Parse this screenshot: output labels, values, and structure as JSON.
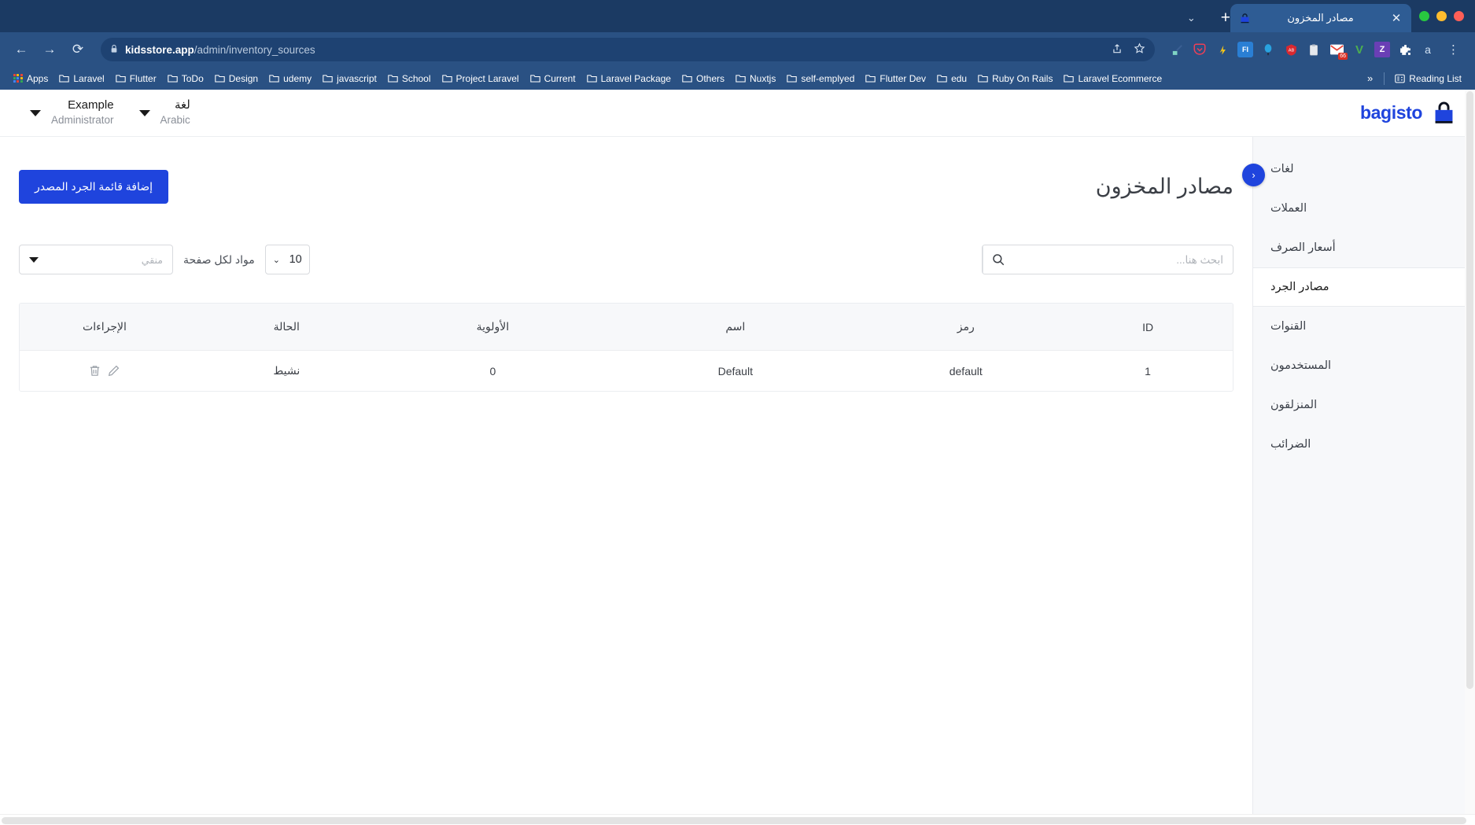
{
  "browser": {
    "tab": {
      "title": "مصادر المخزون",
      "favicon": "bag-icon",
      "close_label": "✕"
    },
    "new_tab_label": "+",
    "window_controls": [
      "close",
      "minimize",
      "maximize"
    ],
    "nav": {
      "back": "←",
      "forward": "→",
      "reload": "⟳"
    },
    "omnibox": {
      "lock": "🔒",
      "url_bold": "kidsstore.app",
      "url_rest": "/admin/inventory_sources",
      "share_icon": "share-icon",
      "bookmark_icon": "star-icon"
    },
    "extensions": [
      {
        "name": "eyedropper-extension",
        "glyph": "🖊",
        "color": "#2f5a8f"
      },
      {
        "name": "pocket-extension",
        "glyph": "▽",
        "color": "#ef3f56"
      },
      {
        "name": "lightning-extension",
        "glyph": "⚡",
        "color": "#f5c518"
      },
      {
        "name": "fi-extension",
        "glyph": "FI",
        "color": "#2a7fd4"
      },
      {
        "name": "balloon-extension",
        "glyph": "◆",
        "color": "#29a3e0"
      },
      {
        "name": "adblock-extension",
        "glyph": "ABP",
        "color": "#d9282f"
      },
      {
        "name": "clipboard-extension",
        "glyph": "▯",
        "color": "#e6e9ee"
      },
      {
        "name": "gmail-extension",
        "glyph": "M",
        "color": "#e94235",
        "badge": "66"
      },
      {
        "name": "vimeo-extension",
        "glyph": "V",
        "color": "#4caf50"
      },
      {
        "name": "zotero-extension",
        "glyph": "Z",
        "color": "#6a3fb5"
      },
      {
        "name": "puzzle-extension",
        "glyph": "🧩",
        "color": "#ffffff"
      },
      {
        "name": "grammarly-extension",
        "glyph": "a",
        "color": "#cfe0f2"
      }
    ],
    "menu_label": "⋮",
    "bookmarks": [
      {
        "label": "Apps",
        "icon": "apps-grid-icon"
      },
      {
        "label": "Laravel",
        "icon": "folder-icon"
      },
      {
        "label": "Flutter",
        "icon": "folder-icon"
      },
      {
        "label": "ToDo",
        "icon": "folder-icon"
      },
      {
        "label": "Design",
        "icon": "folder-icon"
      },
      {
        "label": "udemy",
        "icon": "folder-icon"
      },
      {
        "label": "javascript",
        "icon": "folder-icon"
      },
      {
        "label": "School",
        "icon": "folder-icon"
      },
      {
        "label": "Project Laravel",
        "icon": "folder-icon"
      },
      {
        "label": "Current",
        "icon": "folder-icon"
      },
      {
        "label": "Laravel Package",
        "icon": "folder-icon"
      },
      {
        "label": "Others",
        "icon": "folder-icon"
      },
      {
        "label": "Nuxtjs",
        "icon": "folder-icon"
      },
      {
        "label": "self-emplyed",
        "icon": "folder-icon"
      },
      {
        "label": "Flutter Dev",
        "icon": "folder-icon"
      },
      {
        "label": "edu",
        "icon": "folder-icon"
      },
      {
        "label": "Ruby On Rails",
        "icon": "folder-icon"
      },
      {
        "label": "Laravel Ecommerce",
        "icon": "folder-icon"
      }
    ],
    "bookmarks_overflow": "»",
    "reading_list": {
      "label": "Reading List",
      "icon": "reading-list-icon"
    }
  },
  "app": {
    "brand": {
      "name": "bagisto",
      "color": "#1f44dd",
      "icon": "shopping-bag-icon"
    },
    "account_menu": {
      "name": "Example",
      "role": "Administrator"
    },
    "locale_menu": {
      "name": "لغة",
      "value": "Arabic"
    },
    "sidebar": {
      "collapse_button": "‹",
      "items": [
        {
          "label": "لغات",
          "active": false,
          "has_chevron": false
        },
        {
          "label": "العملات",
          "active": false,
          "has_chevron": false
        },
        {
          "label": "أسعار الصرف",
          "active": false,
          "has_chevron": false
        },
        {
          "label": "مصادر الجرد",
          "active": true,
          "has_chevron": true
        },
        {
          "label": "القنوات",
          "active": false,
          "has_chevron": false
        },
        {
          "label": "المستخدمون",
          "active": false,
          "has_chevron": false
        },
        {
          "label": "المنزلقون",
          "active": false,
          "has_chevron": false
        },
        {
          "label": "الضرائب",
          "active": false,
          "has_chevron": false
        }
      ]
    },
    "page": {
      "title": "مصادر المخزون",
      "add_button": "إضافة قائمة الجرد المصدر",
      "search": {
        "placeholder": "ابحث هنا...",
        "value": ""
      },
      "per_page": {
        "value": "10",
        "label": "مواد لكل صفحة"
      },
      "filter": {
        "placeholder": "منقي",
        "value": ""
      },
      "table": {
        "columns": [
          "ID",
          "رمز",
          "اسم",
          "الأولوية",
          "الحالة",
          "الإجراءات"
        ],
        "rows": [
          {
            "id": "1",
            "code": "default",
            "name": "Default",
            "priority": "0",
            "status": "نشيط",
            "actions": [
              "delete-icon",
              "edit-icon"
            ]
          }
        ]
      }
    }
  }
}
